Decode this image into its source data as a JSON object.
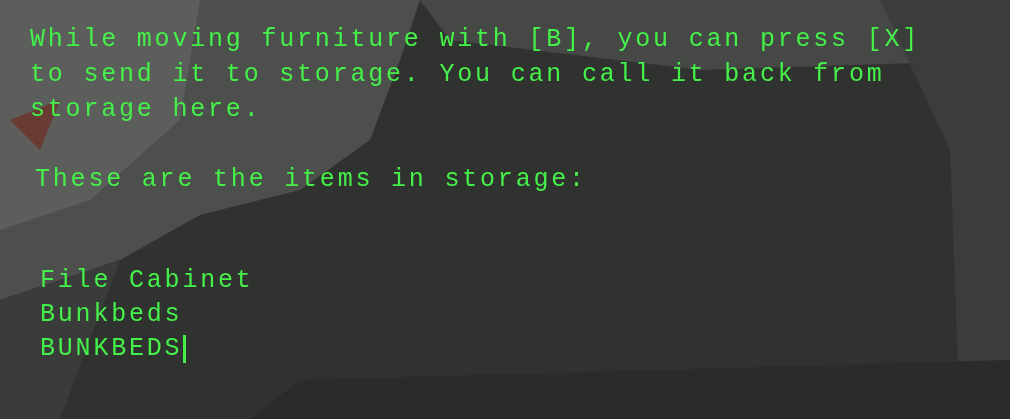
{
  "message": "While moving furniture with [B], you can press [X] to send it to storage. You can call it back from storage here.",
  "heading": "These are the items in storage:",
  "items": [
    "File Cabinet",
    "Bunkbeds"
  ],
  "input": {
    "value": "BUNKBEDS",
    "cursor": true
  }
}
